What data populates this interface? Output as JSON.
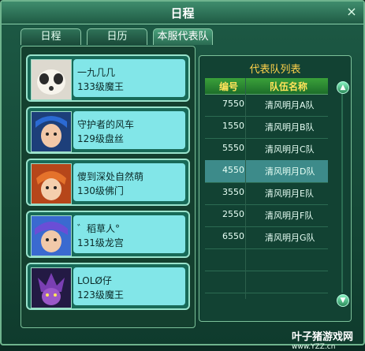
{
  "window": {
    "title": "日程",
    "close_label": "×"
  },
  "tabs": [
    {
      "label": "日程"
    },
    {
      "label": "日历"
    },
    {
      "label": "本服代表队"
    }
  ],
  "members": [
    {
      "name": "一九几几",
      "level": "133级魔王"
    },
    {
      "name": "守护者的风车",
      "level": "129级盘丝"
    },
    {
      "name": "傻到深处自然萌",
      "level": "130级佛门"
    },
    {
      "name": "゛稻草人°",
      "level": "131级龙宫"
    },
    {
      "name": "LOLØ仔",
      "level": "123级魔王"
    }
  ],
  "team_list": {
    "title": "代表队列表",
    "col_id": "编号",
    "col_name": "队伍名称",
    "rows": [
      {
        "id": "7550",
        "name": "清风明月A队"
      },
      {
        "id": "1550",
        "name": "清风明月B队"
      },
      {
        "id": "5550",
        "name": "清风明月C队"
      },
      {
        "id": "4550",
        "name": "清风明月D队"
      },
      {
        "id": "3550",
        "name": "清风明月E队"
      },
      {
        "id": "2550",
        "name": "清风明月F队"
      },
      {
        "id": "6550",
        "name": "清风明月G队"
      }
    ],
    "selected_id": "4550"
  },
  "watermark": {
    "main": "叶子猪游戏网",
    "sub": "www.YZZ.cn"
  },
  "colors": {
    "accent": "#ffd24a",
    "selected_row": "#3d8b8a"
  }
}
